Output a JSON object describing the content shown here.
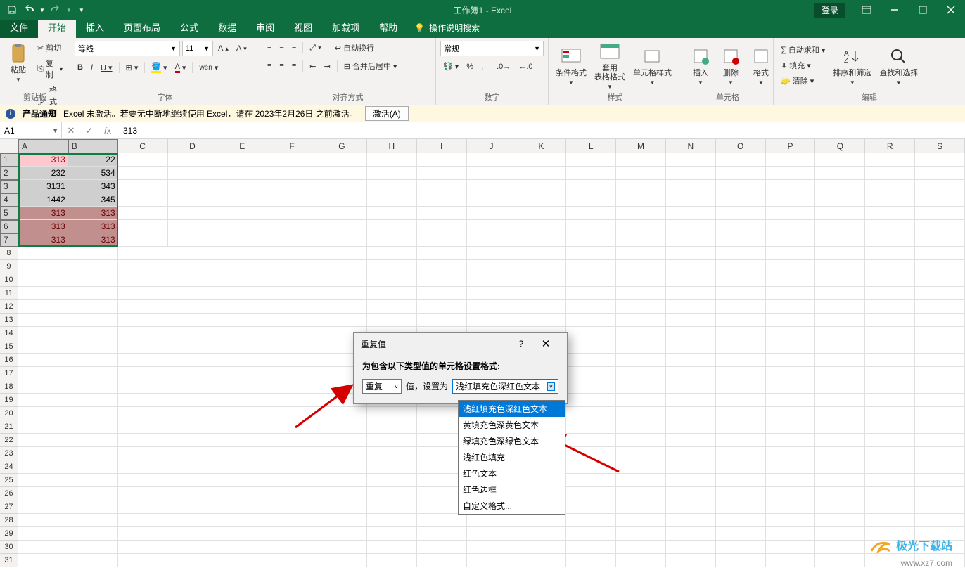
{
  "titlebar": {
    "title": "工作簿1 - Excel",
    "login": "登录"
  },
  "tabs": {
    "file": "文件",
    "home": "开始",
    "insert": "插入",
    "layout": "页面布局",
    "formulas": "公式",
    "data": "数据",
    "review": "审阅",
    "view": "视图",
    "addins": "加载项",
    "help": "帮助",
    "tell": "操作说明搜索"
  },
  "ribbon": {
    "clipboard": {
      "paste": "粘贴",
      "cut": "剪切",
      "copy": "复制",
      "fmtpaint": "格式刷",
      "label": "剪贴板"
    },
    "font": {
      "name": "等线",
      "size": "11",
      "label": "字体"
    },
    "align": {
      "wrap": "自动换行",
      "merge": "合并后居中",
      "label": "对齐方式"
    },
    "number": {
      "fmt": "常规",
      "label": "数字"
    },
    "styles": {
      "cond": "条件格式",
      "table": "套用\n表格格式",
      "cell": "单元格样式",
      "label": "样式"
    },
    "cells": {
      "insert": "插入",
      "delete": "删除",
      "format": "格式",
      "label": "单元格"
    },
    "editing": {
      "sum": "自动求和",
      "fill": "填充",
      "clear": "清除",
      "sort": "排序和筛选",
      "find": "查找和选择",
      "label": "编辑"
    }
  },
  "activation": {
    "tag": "产品通知",
    "msg": "Excel 未激活。若要无中断地继续使用 Excel，请在 2023年2月26日 之前激活。",
    "btn": "激活(A)"
  },
  "formula": {
    "name": "A1",
    "value": "313"
  },
  "columns": [
    "A",
    "B",
    "C",
    "D",
    "E",
    "F",
    "G",
    "H",
    "I",
    "J",
    "K",
    "L",
    "M",
    "N",
    "O",
    "P",
    "Q",
    "R",
    "S"
  ],
  "cells": {
    "A": [
      "313",
      "232",
      "3131",
      "1442",
      "313",
      "313",
      "313"
    ],
    "B": [
      "22",
      "534",
      "343",
      "345",
      "313",
      "313",
      "313"
    ]
  },
  "dialog": {
    "title": "重复值",
    "desc": "为包含以下类型值的单元格设置格式:",
    "type": "重复",
    "setlabel": "值，设置为",
    "value": "浅红填充色深红色文本",
    "options": [
      "浅红填充色深红色文本",
      "黄填充色深黄色文本",
      "绿填充色深绿色文本",
      "浅红色填充",
      "红色文本",
      "红色边框",
      "自定义格式..."
    ]
  },
  "watermark": {
    "l1": "极光下载站",
    "l2": "www.xz7.com"
  }
}
